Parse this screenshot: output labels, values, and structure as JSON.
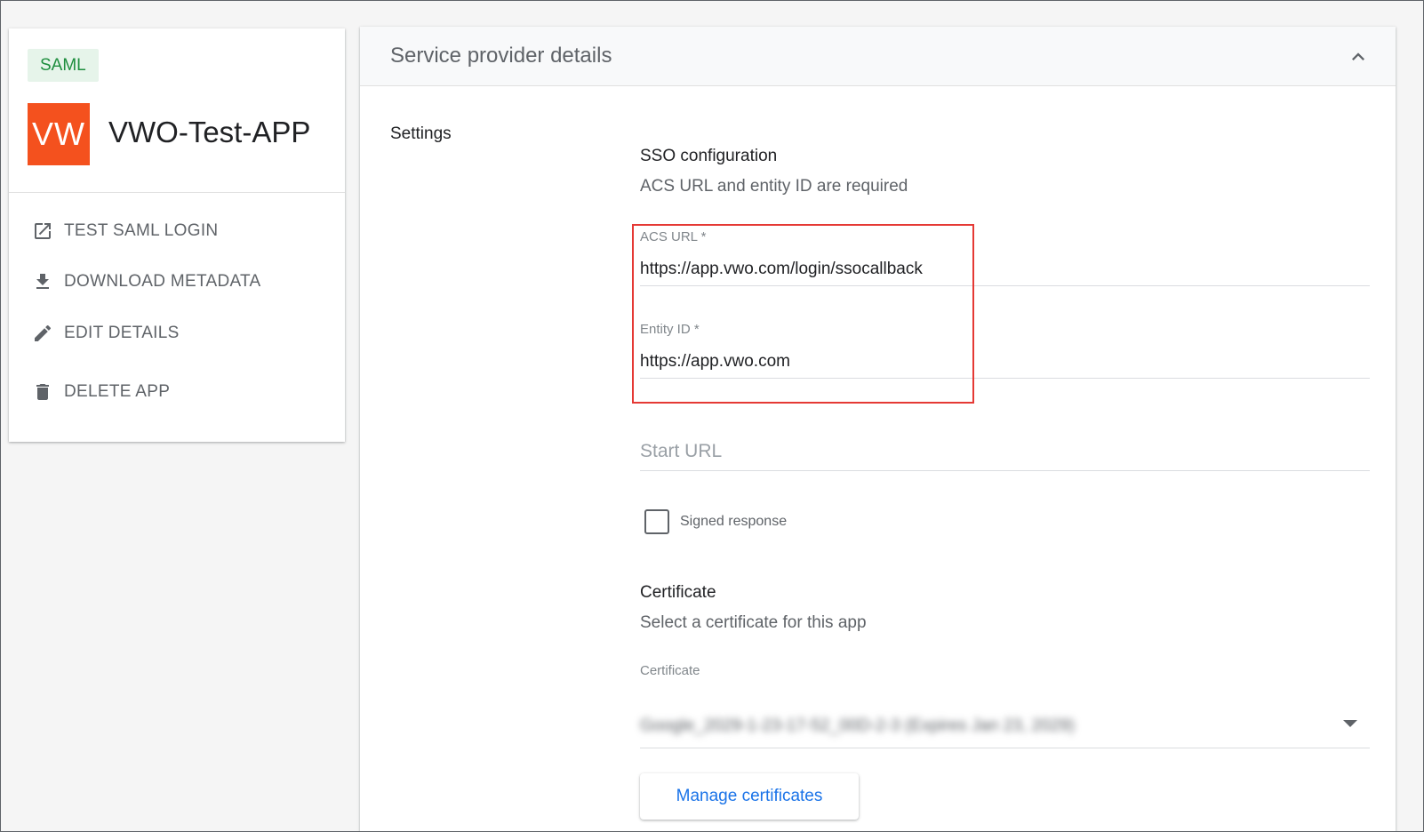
{
  "app": {
    "badge": "SAML",
    "logo_text": "VW",
    "logo_color": "#f4511e",
    "name": "VWO-Test-APP",
    "actions": [
      {
        "label": "TEST SAML LOGIN",
        "icon": "open-in-new-icon"
      },
      {
        "label": "DOWNLOAD METADATA",
        "icon": "download-icon"
      },
      {
        "label": "EDIT DETAILS",
        "icon": "pencil-icon"
      },
      {
        "label": "DELETE APP",
        "icon": "trash-icon"
      }
    ]
  },
  "panel": {
    "title": "Service provider details",
    "settings_label": "Settings",
    "sso": {
      "title": "SSO configuration",
      "subtitle": "ACS URL and entity ID are required",
      "acs_label": "ACS URL *",
      "acs_value": "https://app.vwo.com/login/ssocallback",
      "entity_label": "Entity ID *",
      "entity_value": "https://app.vwo.com",
      "start_url_placeholder": "Start URL",
      "signed_response_label": "Signed response",
      "signed_response_checked": false
    },
    "certificate": {
      "title": "Certificate",
      "subtitle": "Select a certificate for this app",
      "field_label": "Certificate",
      "selected_value": "Google_2029-1-23-17-52_00D-2-3 (Expires Jan 23, 2029)",
      "manage_button": "Manage certificates"
    }
  },
  "colors": {
    "badge_bg": "#e6f4ea",
    "badge_text": "#1e8e3e",
    "highlight": "#e53935",
    "accent": "#1a73e8"
  }
}
